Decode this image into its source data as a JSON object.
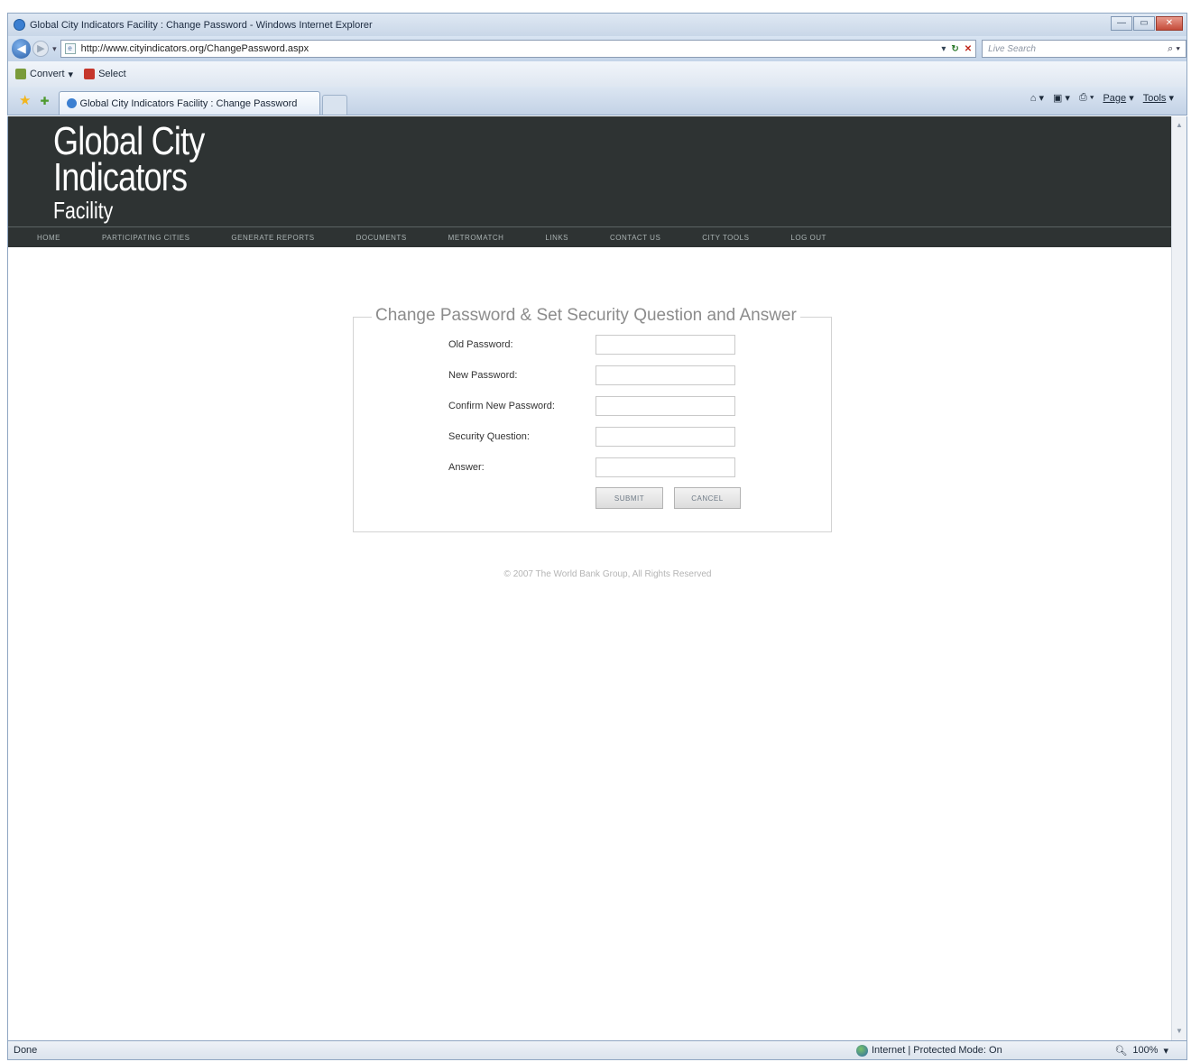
{
  "window": {
    "title": "Global City Indicators Facility : Change Password - Windows Internet Explorer",
    "minimize": "—",
    "maximize": "▭",
    "close": "✕"
  },
  "address": {
    "url": "http://www.cityindicators.org/ChangePassword.aspx",
    "search_placeholder": "Live Search"
  },
  "commandbar": {
    "convert_label": "Convert",
    "select_label": "Select"
  },
  "tabs": [
    {
      "label": "Global City Indicators Facility : Change Password"
    }
  ],
  "toolbar_right": {
    "page_label": "Page",
    "tools_label": "Tools"
  },
  "site": {
    "logo_line1": "Global City",
    "logo_line2": "Indicators",
    "logo_line3": "Facility",
    "nav": [
      "HOME",
      "PARTICIPATING CITIES",
      "GENERATE REPORTS",
      "DOCUMENTS",
      "METROMATCH",
      "LINKS",
      "CONTACT US",
      "CITY TOOLS",
      "LOG OUT"
    ]
  },
  "form": {
    "legend": "Change Password & Set Security Question and Answer",
    "fields": [
      {
        "label": "Old Password:",
        "value": ""
      },
      {
        "label": "New Password:",
        "value": ""
      },
      {
        "label": "Confirm New Password:",
        "value": ""
      },
      {
        "label": "Security Question:",
        "value": ""
      },
      {
        "label": "Answer:",
        "value": ""
      }
    ],
    "submit_label": "SUBMIT",
    "cancel_label": "CANCEL"
  },
  "footer": {
    "copyright": "© 2007 The World Bank Group, All Rights Reserved"
  },
  "status": {
    "text": "Done",
    "zone": "Internet | Protected Mode: On",
    "zoom": "100%"
  }
}
